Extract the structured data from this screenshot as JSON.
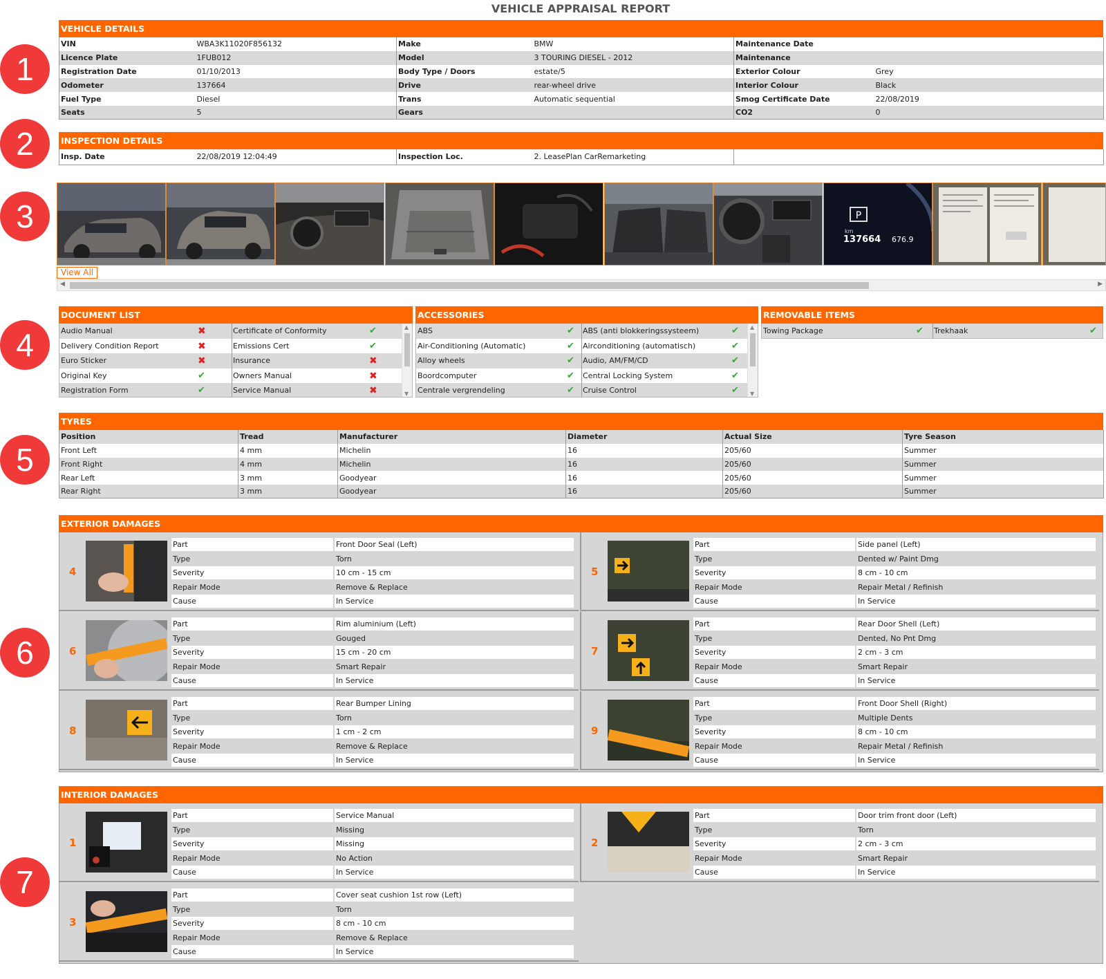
{
  "report_title": "VEHICLE APPRAISAL REPORT",
  "markers": [
    "1",
    "2",
    "3",
    "4",
    "5",
    "6",
    "7"
  ],
  "vehicle_details": {
    "header": "VEHICLE DETAILS",
    "rows": [
      [
        [
          "VIN",
          "WBA3K11020F856132"
        ],
        [
          "Make",
          "BMW"
        ],
        [
          "Maintenance Date",
          ""
        ]
      ],
      [
        [
          "Licence Plate",
          "1FUB012"
        ],
        [
          "Model",
          "3 TOURING DIESEL - 2012"
        ],
        [
          "Maintenance",
          ""
        ]
      ],
      [
        [
          "Registration Date",
          "01/10/2013"
        ],
        [
          "Body Type / Doors",
          "estate/5"
        ],
        [
          "Exterior Colour",
          "Grey"
        ]
      ],
      [
        [
          "Odometer",
          "137664"
        ],
        [
          "Drive",
          "rear-wheel drive"
        ],
        [
          "Interior Colour",
          "Black"
        ]
      ],
      [
        [
          "Fuel Type",
          "Diesel"
        ],
        [
          "Trans",
          "Automatic sequential"
        ],
        [
          "Smog Certificate Date",
          "22/08/2019"
        ]
      ],
      [
        [
          "Seats",
          "5"
        ],
        [
          "Gears",
          ""
        ],
        [
          "CO2",
          "0"
        ]
      ]
    ]
  },
  "inspection_details": {
    "header": "INSPECTION DETAILS",
    "date_label": "Insp. Date",
    "date_value": "22/08/2019 12:04:49",
    "loc_label": "Inspection Loc.",
    "loc_value": "2. LeasePlan CarRemarketing"
  },
  "photos": {
    "view_all": "View All",
    "items": [
      "front-left-exterior",
      "rear-right-exterior",
      "dashboard",
      "trunk",
      "accessories-bag",
      "rear-seats",
      "interior-cockpit",
      "odometer-display",
      "documents",
      "documents-partial"
    ],
    "odometer_text": "137664",
    "odometer_km": "km",
    "odometer_range": "676.9",
    "gear": "P"
  },
  "document_list": {
    "header": "DOCUMENT LIST",
    "rows": [
      [
        [
          "Audio Manual",
          false
        ],
        [
          "Certificate of Conformity",
          true
        ]
      ],
      [
        [
          "Delivery Condition Report",
          false
        ],
        [
          "Emissions Cert",
          true
        ]
      ],
      [
        [
          "Euro Sticker",
          false
        ],
        [
          "Insurance",
          false
        ]
      ],
      [
        [
          "Original Key",
          true
        ],
        [
          "Owners Manual",
          false
        ]
      ],
      [
        [
          "Registration Form",
          true
        ],
        [
          "Service Manual",
          false
        ]
      ]
    ]
  },
  "accessories": {
    "header": "ACCESSORIES",
    "rows": [
      [
        [
          "ABS",
          true
        ],
        [
          "ABS (anti blokkeringssysteem)",
          true
        ]
      ],
      [
        [
          "Air-Conditioning (Automatic)",
          true
        ],
        [
          "Airconditioning (automatisch)",
          true
        ]
      ],
      [
        [
          "Alloy wheels",
          true
        ],
        [
          "Audio, AM/FM/CD",
          true
        ]
      ],
      [
        [
          "Boordcomputer",
          true
        ],
        [
          "Central Locking System",
          true
        ]
      ],
      [
        [
          "Centrale vergrendeling",
          true
        ],
        [
          "Cruise Control",
          true
        ]
      ]
    ]
  },
  "removable_items": {
    "header": "REMOVABLE ITEMS",
    "rows": [
      [
        [
          "Towing Package",
          true
        ],
        [
          "Trekhaak",
          true
        ]
      ]
    ]
  },
  "check_glyphs": {
    "ok": "✔",
    "no": "✖"
  },
  "tyres": {
    "header": "TYRES",
    "columns": [
      "Position",
      "Tread",
      "Manufacturer",
      "Diameter",
      "Actual Size",
      "Tyre Season"
    ],
    "rows": [
      [
        "Front Left",
        "4 mm",
        "Michelin",
        "16",
        "205/60",
        "Summer"
      ],
      [
        "Front Right",
        "4 mm",
        "Michelin",
        "16",
        "205/60",
        "Summer"
      ],
      [
        "Rear Left",
        "3 mm",
        "Goodyear",
        "16",
        "205/60",
        "Summer"
      ],
      [
        "Rear Right",
        "3 mm",
        "Goodyear",
        "16",
        "205/60",
        "Summer"
      ]
    ]
  },
  "field_labels": [
    "Part",
    "Type",
    "Severity",
    "Repair Mode",
    "Cause"
  ],
  "exterior_damages": {
    "header": "EXTERIOR DAMAGES",
    "items": [
      {
        "num": "4",
        "values": [
          "Front Door Seal (Left)",
          "Torn",
          "10 cm - 15 cm",
          "Remove & Replace",
          "In Service"
        ]
      },
      {
        "num": "5",
        "values": [
          "Side panel (Left)",
          "Dented w/ Paint Dmg",
          "8 cm - 10 cm",
          "Repair Metal / Refinish",
          "In Service"
        ]
      },
      {
        "num": "6",
        "values": [
          "Rim aluminium (Left)",
          "Gouged",
          "15 cm - 20 cm",
          "Smart Repair",
          "In Service"
        ]
      },
      {
        "num": "7",
        "values": [
          "Rear Door Shell (Left)",
          "Dented, No Pnt Dmg",
          "2 cm - 3 cm",
          "Smart Repair",
          "In Service"
        ]
      },
      {
        "num": "8",
        "values": [
          "Rear Bumper Lining",
          "Torn",
          "1 cm - 2 cm",
          "Remove & Replace",
          "In Service"
        ]
      },
      {
        "num": "9",
        "values": [
          "Front Door Shell (Right)",
          "Multiple Dents",
          "8 cm - 10 cm",
          "Repair Metal / Refinish",
          "In Service"
        ]
      }
    ]
  },
  "interior_damages": {
    "header": "INTERIOR DAMAGES",
    "items": [
      {
        "num": "1",
        "values": [
          "Service Manual",
          "Missing",
          "Missing",
          "No Action",
          "In Service"
        ]
      },
      {
        "num": "2",
        "values": [
          "Door trim front door (Left)",
          "Torn",
          "2 cm - 3 cm",
          "Smart Repair",
          "In Service"
        ]
      },
      {
        "num": "3",
        "values": [
          "Cover seat cushion 1st row (Left)",
          "Torn",
          "8 cm - 10 cm",
          "Remove & Replace",
          "In Service"
        ]
      }
    ]
  },
  "colors": {
    "accent": "#ff6600",
    "marker": "#f03a3a",
    "row_grey": "#d9d9d9",
    "ok": "#3aa63a",
    "no": "#e02020"
  }
}
